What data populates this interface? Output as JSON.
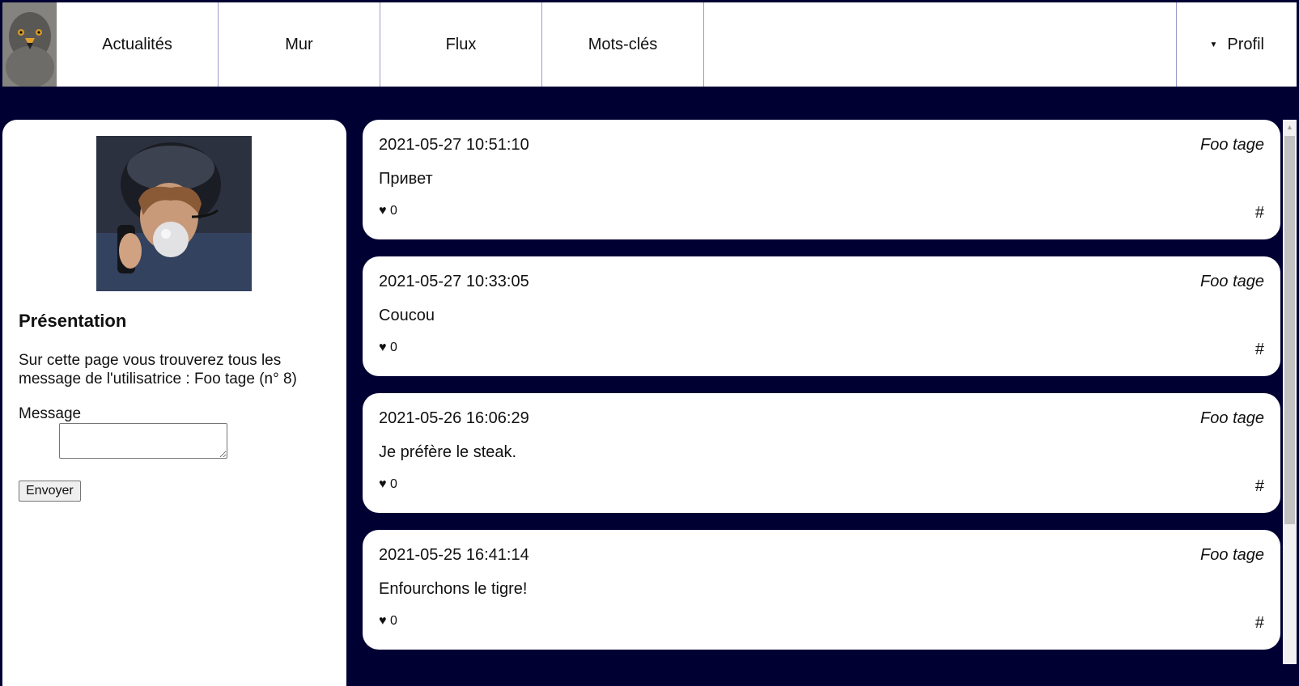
{
  "nav": {
    "items": [
      {
        "label": "Actualités"
      },
      {
        "label": "Mur"
      },
      {
        "label": "Flux"
      },
      {
        "label": "Mots-clés"
      }
    ],
    "profile_caret": "▼",
    "profile_label": "Profil"
  },
  "sidebar": {
    "title": "Présentation",
    "intro": "Sur cette page vous trouverez tous les message de l'utilisatrice : Foo tage (n° 8)",
    "message_label": "Message",
    "message_value": "",
    "send_label": "Envoyer"
  },
  "posts": [
    {
      "date": "2021-05-27 10:51:10",
      "author": "Foo tage",
      "text": "Привет",
      "likes": "♥ 0",
      "tag": "#"
    },
    {
      "date": "2021-05-27 10:33:05",
      "author": "Foo tage",
      "text": "Coucou",
      "likes": "♥ 0",
      "tag": "#"
    },
    {
      "date": "2021-05-26 16:06:29",
      "author": "Foo tage",
      "text": "Je préfère le steak.",
      "likes": "♥ 0",
      "tag": "#"
    },
    {
      "date": "2021-05-25 16:41:14",
      "author": "Foo tage",
      "text": "Enfourchons le tigre!",
      "likes": "♥ 0",
      "tag": "#"
    }
  ],
  "colors": {
    "background": "#000033",
    "panel": "#ffffff",
    "divider": "#9a9acb"
  },
  "icons": {
    "logo": "eagle-logo-icon",
    "avatar": "profile-photo",
    "caret": "caret-down-icon"
  }
}
